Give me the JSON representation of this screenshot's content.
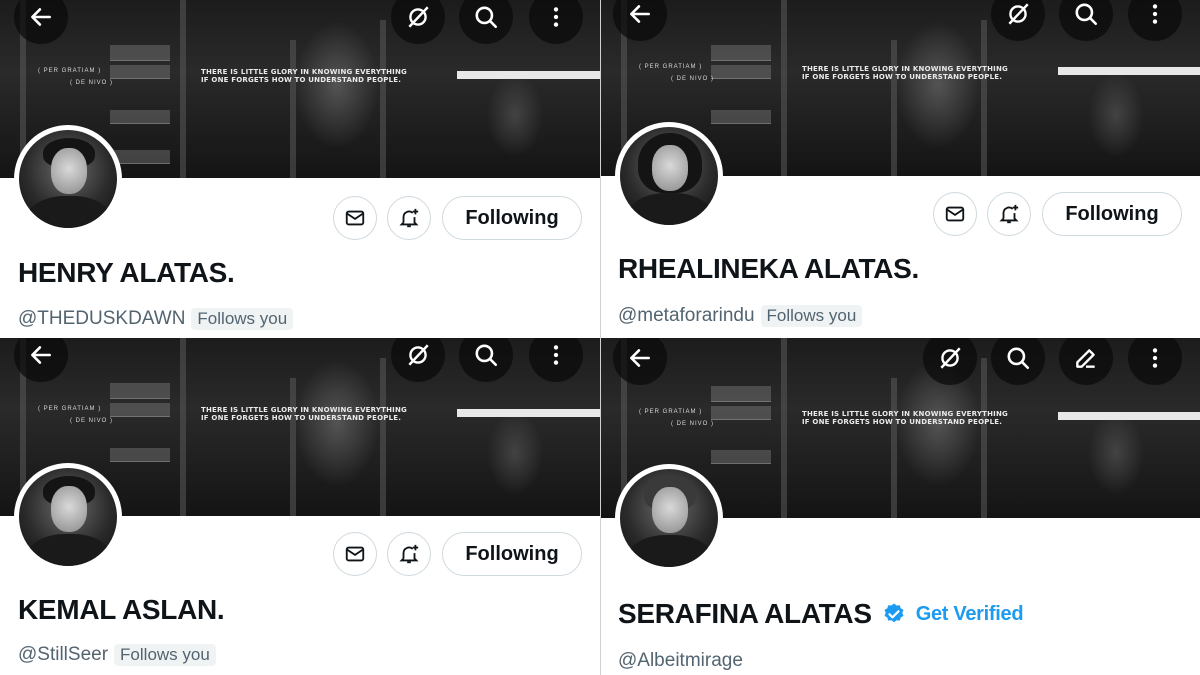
{
  "banner": {
    "left_text_line1": "( PER GRATIAM )",
    "left_text_line2": "( DE NIVO )",
    "quote": "THERE IS LITTLE GLORY IN KNOWING EVERYTHING IF ONE FORGETS HOW TO UNDERSTAND PEOPLE."
  },
  "buttons": {
    "following_label": "Following"
  },
  "profiles": [
    {
      "name": "HENRY ALATAS.",
      "handle": "@THEDUSKDAWN",
      "follows_you": "Follows you"
    },
    {
      "name": "RHEALINEKA ALATAS.",
      "handle": "@metaforarindu",
      "follows_you": "Follows you"
    },
    {
      "name": "KEMAL ASLAN.",
      "handle": "@StillSeer",
      "follows_you": "Follows you"
    },
    {
      "name": "SERAFINA ALATAS",
      "handle": "@Albeitmirage",
      "get_verified": "Get Verified"
    }
  ],
  "icons": [
    "back-arrow-icon",
    "grok-icon",
    "search-icon",
    "more-icon",
    "edit-icon",
    "message-icon",
    "bell-plus-icon",
    "verified-badge-icon"
  ],
  "colors": {
    "accent": "#1d9bf0",
    "text": "#0f1419",
    "muted": "#536471"
  }
}
